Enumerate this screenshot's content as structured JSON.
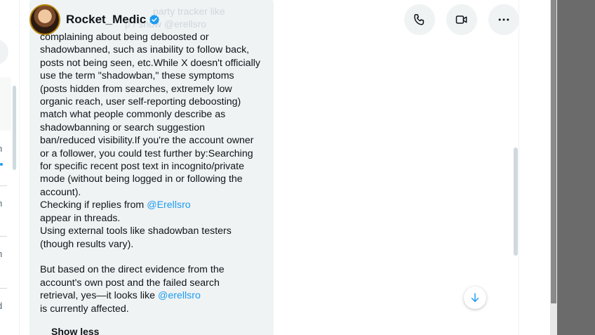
{
  "left_column": {
    "fragments": [
      "n",
      "h",
      "h",
      "d"
    ]
  },
  "conversation": {
    "user_name": "Rocket_Medic",
    "faded_top_line": "party tracker like",
    "faded_second_line": "p / show @erellsro",
    "message_lines": [
      "complaining about being deboosted or",
      "shadowbanned, such as inability to follow back,",
      "posts not being seen, etc.While X doesn't officially",
      "use the term \"shadowban,\" these symptoms",
      "(posts hidden from searches, extremely low",
      "organic reach, user self-reporting deboosting)",
      "match what people commonly describe as",
      "shadowbanning or search suggestion",
      "ban/reduced visibility.If you're the account owner",
      "or a follower, you could test further by:Searching",
      "for specific recent post text in incognito/private",
      "mode (without being logged in or following the",
      "account)."
    ],
    "replies_line_prefix": "Checking if replies from ",
    "replies_mention": "@Erellsro",
    "replies_line_suffix": " appear in threads.",
    "tools_line_1": "Using external tools like shadowban testers",
    "tools_line_2": "(though results vary).",
    "evidence_line_1": "But based on the direct evidence from the",
    "evidence_line_2": "account's own post and the failed search",
    "evidence_line_3_prefix": "retrieval, yes—it looks like ",
    "evidence_mention": "@erellsro",
    "evidence_line_4": " is currently affected.",
    "show_less_label": "Show less"
  },
  "actions": {
    "call_icon": "phone-icon",
    "video_icon": "video-camera-icon",
    "more_icon": "more-horizontal-icon"
  },
  "scroll_down_icon": "arrow-down-icon",
  "colors": {
    "accent": "#1d9bf0",
    "bubble": "#eff3f4",
    "text": "#0f1419"
  }
}
